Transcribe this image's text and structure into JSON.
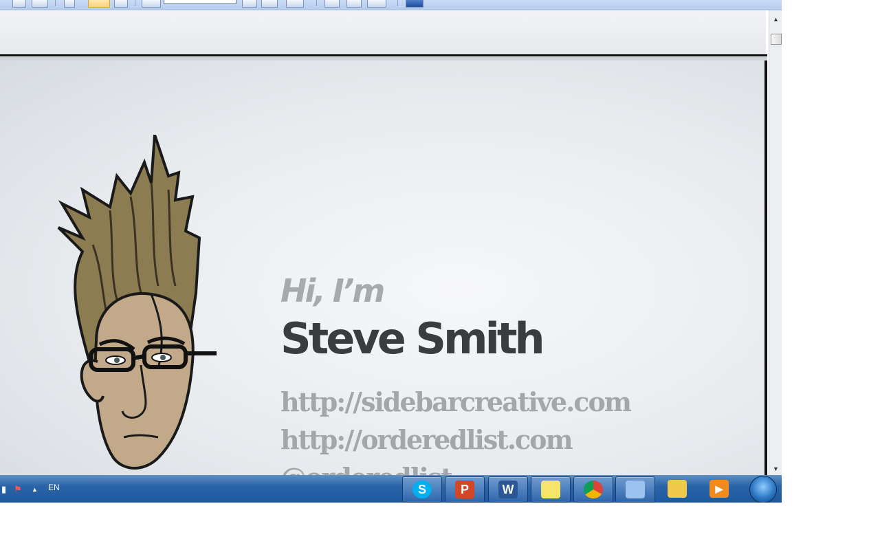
{
  "slide": {
    "greeting": "Hi, I’m",
    "name": "Steve Smith",
    "links": [
      "http://sidebarcreative.com",
      "http://orderedlist.com",
      "@orderedlist"
    ]
  },
  "taskbar": {
    "language": "EN",
    "tray_arrow": "▲",
    "apps": [
      {
        "name": "skype",
        "glyph": "S",
        "color": "#00aff0"
      },
      {
        "name": "powerpoint",
        "glyph": "P",
        "color": "#d24726"
      },
      {
        "name": "word",
        "glyph": "W",
        "color": "#2b5797"
      },
      {
        "name": "sticky-notes",
        "glyph": "",
        "color": "#f5e66b"
      },
      {
        "name": "chrome",
        "glyph": "",
        "color": "#e8b21c"
      },
      {
        "name": "paint",
        "glyph": "",
        "color": "#9cc3f0"
      },
      {
        "name": "file-explorer",
        "glyph": "",
        "color": "#f0c84a"
      },
      {
        "name": "media-player",
        "glyph": "▶",
        "color": "#f28b1d"
      }
    ]
  },
  "scrollbar": {
    "up_glyph": "▲",
    "down_glyph": "▼"
  }
}
